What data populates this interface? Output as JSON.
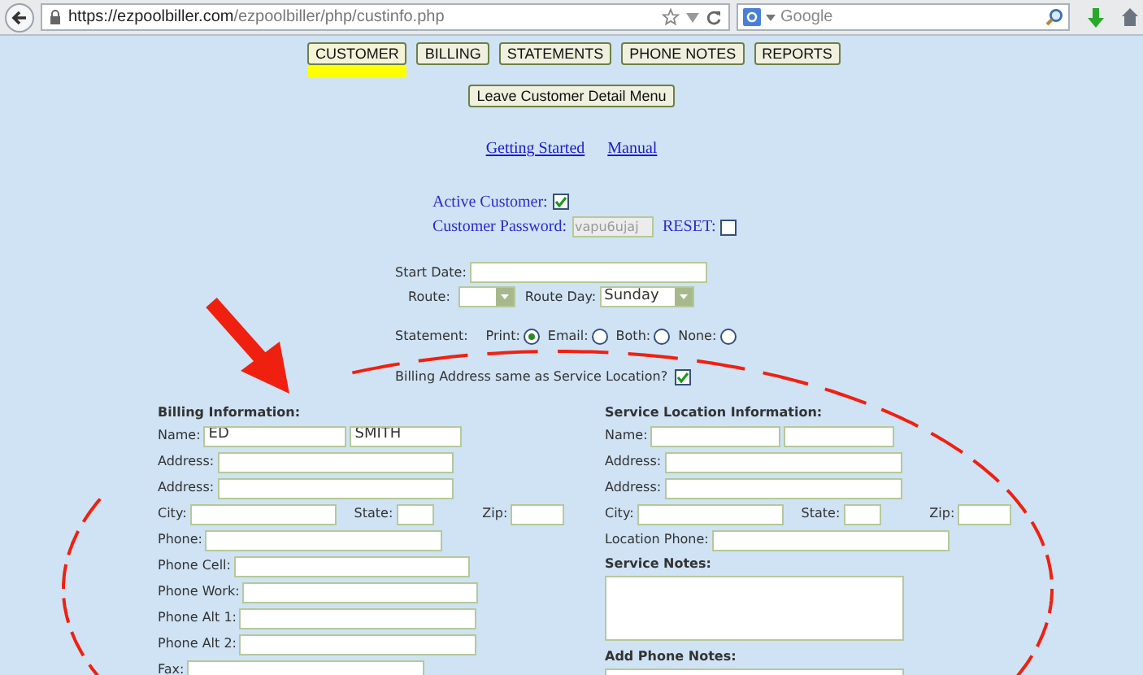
{
  "browser": {
    "url_host": "https://ezpoolbiller.com",
    "url_path": "/ezpoolbiller/php/custinfo.php",
    "search_placeholder": "Google"
  },
  "tabs": [
    {
      "label": "CUSTOMER",
      "selected": true
    },
    {
      "label": "BILLING",
      "selected": false
    },
    {
      "label": "STATEMENTS",
      "selected": false
    },
    {
      "label": "PHONE NOTES",
      "selected": false
    },
    {
      "label": "REPORTS",
      "selected": false
    }
  ],
  "leave_button": "Leave Customer Detail Menu",
  "links": [
    "Getting Started",
    "Manual"
  ],
  "active_customer": {
    "label": "Active Customer:",
    "checked": true
  },
  "password": {
    "label": "Customer Password:",
    "value": "vapu6ujaj",
    "reset_label": "RESET:",
    "reset_checked": false
  },
  "start_date": {
    "label": "Start Date:"
  },
  "route": {
    "label": "Route:"
  },
  "route_day": {
    "label": "Route Day:",
    "value": "Sunday"
  },
  "statement": {
    "label": "Statement:",
    "options": [
      {
        "label": "Print:",
        "selected": true
      },
      {
        "label": "Email:",
        "selected": false
      },
      {
        "label": "Both:",
        "selected": false
      },
      {
        "label": "None:",
        "selected": false
      }
    ]
  },
  "same_address": {
    "label": "Billing Address same as Service Location?",
    "checked": true
  },
  "billing": {
    "title": "Billing Information:",
    "rows": [
      {
        "kind": "name",
        "label": "Name:",
        "values": [
          "ED",
          "SMITH"
        ]
      },
      {
        "kind": "line",
        "label": "Address:"
      },
      {
        "kind": "line",
        "label": "Address:"
      },
      {
        "kind": "city",
        "labels": [
          "City:",
          "State:",
          "Zip:"
        ]
      },
      {
        "kind": "line",
        "label": "Phone:"
      },
      {
        "kind": "line",
        "label": "Phone Cell:"
      },
      {
        "kind": "line",
        "label": "Phone Work:"
      },
      {
        "kind": "line",
        "label": "Phone Alt 1:"
      },
      {
        "kind": "line",
        "label": "Phone Alt 2:"
      },
      {
        "kind": "line",
        "label": "Fax:"
      }
    ]
  },
  "service": {
    "title": "Service Location Information:",
    "rows": [
      {
        "kind": "name",
        "label": "Name:"
      },
      {
        "kind": "line",
        "label": "Address:"
      },
      {
        "kind": "line",
        "label": "Address:"
      },
      {
        "kind": "city",
        "labels": [
          "City:",
          "State:",
          "Zip:"
        ]
      },
      {
        "kind": "line",
        "label": "Location Phone:"
      },
      {
        "kind": "notes",
        "label": "Service Notes:"
      },
      {
        "kind": "notes",
        "label": "Add Phone Notes:"
      }
    ]
  }
}
